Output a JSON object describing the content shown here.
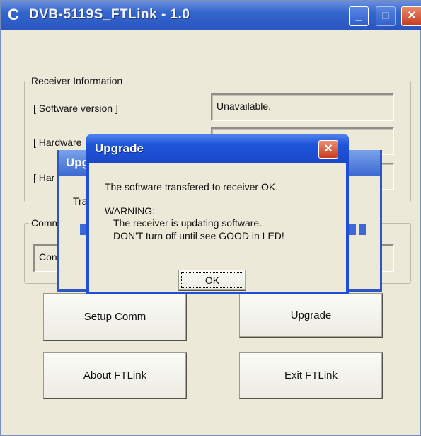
{
  "window": {
    "title": "DVB-5119S_FTLink - 1.0",
    "minimize": "_",
    "maximize": "□",
    "close": "✕"
  },
  "receiver_info": {
    "legend": "Receiver Information",
    "software_label": "[ Software version ]",
    "software_value": "Unavailable.",
    "hardware1_label": "[ Hardware",
    "hardware2_label": "[ Har"
  },
  "comm": {
    "legend": "Comm",
    "field_value": "Con"
  },
  "buttons": {
    "setup_comm": "Setup Comm",
    "upgrade": "Upgrade",
    "about": "About FTLink",
    "exit": "Exit FTLink"
  },
  "bg_dialog": {
    "title": "Upg",
    "label": "Tra"
  },
  "modal": {
    "title": "Upgrade",
    "close": "✕",
    "line1": "The software transfered to receiver OK.",
    "warning": "WARNING:",
    "line2": "The receiver is updating software.",
    "line3": "DON'T turn off until see GOOD in LED!",
    "ok": "OK"
  },
  "colors": {
    "titlebar": "#2a55c0",
    "dialog_border": "#1e4fd6",
    "face": "#ece9d8",
    "close_red": "#c93a1e"
  }
}
